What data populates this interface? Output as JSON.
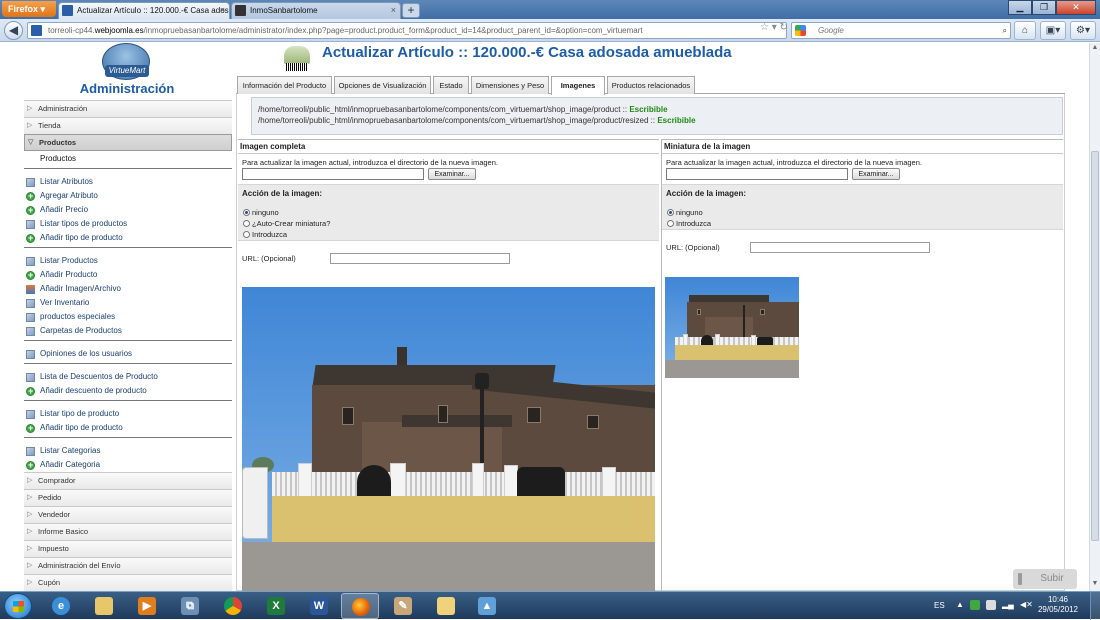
{
  "browser": {
    "menu_button": "Firefox ▾",
    "tabs": [
      {
        "label": "Actualizar Artículo :: 120.000.-€ Casa adosada ...",
        "active": true
      },
      {
        "label": "InmoSanbartolome",
        "active": false
      }
    ],
    "url_domain": "torreoli-cp44.",
    "url_host": "webjoomla.es",
    "url_path": "/inmopruebasanbartolome/administrator/index.php?page=product.product_form&product_id=14&product_parent_id=&option=com_virtuemart",
    "search_placeholder": "Google"
  },
  "sidebar": {
    "logo_text": "VirtueMart",
    "title": "Administración",
    "sections_top": [
      "Administración",
      "Tienda"
    ],
    "open_section": "Productos",
    "open_sub": "Productos",
    "group1": [
      {
        "label": "Listar Atributos",
        "icon": "list-icon"
      },
      {
        "label": "Agregar Atributo",
        "icon": "add-icon"
      },
      {
        "label": "Añadir Precio",
        "icon": "add-icon"
      },
      {
        "label": "Listar tipos de productos",
        "icon": "list-icon"
      },
      {
        "label": "Añadir tipo de producto",
        "icon": "add-icon"
      }
    ],
    "group2": [
      {
        "label": "Listar Productos",
        "icon": "list-icon"
      },
      {
        "label": "Añadir Producto",
        "icon": "add-icon"
      },
      {
        "label": "Añadir Imagen/Archivo",
        "icon": "image-icon"
      },
      {
        "label": "Ver Inventario",
        "icon": "list-icon"
      },
      {
        "label": "productos especiales",
        "icon": "list-icon"
      },
      {
        "label": "Carpetas de Productos",
        "icon": "list-icon"
      }
    ],
    "group3": [
      {
        "label": "Opiniones de los usuarios",
        "icon": "list-icon"
      }
    ],
    "group4": [
      {
        "label": "Lista de Descuentos de Producto",
        "icon": "list-icon"
      },
      {
        "label": "Añadir descuento de producto",
        "icon": "add-icon"
      }
    ],
    "group5": [
      {
        "label": "Listar tipo de producto",
        "icon": "list-icon"
      },
      {
        "label": "Añadir tipo de producto",
        "icon": "add-icon"
      }
    ],
    "group6": [
      {
        "label": "Listar Categorias",
        "icon": "list-icon"
      },
      {
        "label": "Añadir Categoria",
        "icon": "add-icon"
      }
    ],
    "sections_bottom": [
      "Comprador",
      "Pedido",
      "Vendedor",
      "Informe Basico",
      "Impuesto",
      "Administración del Envío",
      "Cupón"
    ]
  },
  "main": {
    "title": "Actualizar Artículo :: 120.000.-€ Casa adosada amueblada",
    "tabs": [
      "Información del Producto",
      "Opciones de Visualización",
      "Estado",
      "Dimensiones y Peso",
      "Imagenes",
      "Productos relacionados"
    ],
    "active_tab": "Imagenes",
    "paths": [
      {
        "path": "/home/torreoli/public_html/inmopruebasanbartolome/components/com_virtuemart/shop_image/product ::",
        "status": "Escribible"
      },
      {
        "path": "/home/torreoli/public_html/inmopruebasanbartolome/components/com_virtuemart/shop_image/product/resized ::",
        "status": "Escribible"
      }
    ],
    "full_image": {
      "heading": "Imagen completa",
      "hint": "Para actualizar la imagen actual, introduzca el directorio de la nueva imagen.",
      "browse": "Examinar...",
      "action_label": "Acción de la imagen:",
      "options": [
        "ninguno",
        "¿Auto-Crear miniatura?",
        "Introduzca"
      ],
      "selected": "ninguno",
      "url_label": "URL: (Opcional)"
    },
    "thumb_image": {
      "heading": "Miniatura de la imagen",
      "hint": "Para actualizar la imagen actual, introduzca el directorio de la nueva imagen.",
      "browse": "Examinar...",
      "action_label": "Acción de la imagen:",
      "options": [
        "ninguno",
        "Introduzca"
      ],
      "selected": "ninguno",
      "url_label": "URL: (Opcional)"
    },
    "scroll_top_button": "Subir"
  },
  "taskbar": {
    "apps": [
      "internet-explorer",
      "file-explorer",
      "media-player",
      "network",
      "chrome",
      "excel",
      "word",
      "firefox",
      "paint-app",
      "folder",
      "image-viewer"
    ],
    "active_app": "firefox",
    "language": "ES",
    "time": "10:46",
    "date": "29/05/2012"
  },
  "colors": {
    "title_blue": "#1d5ca6",
    "writable_green": "#1f8a12"
  }
}
